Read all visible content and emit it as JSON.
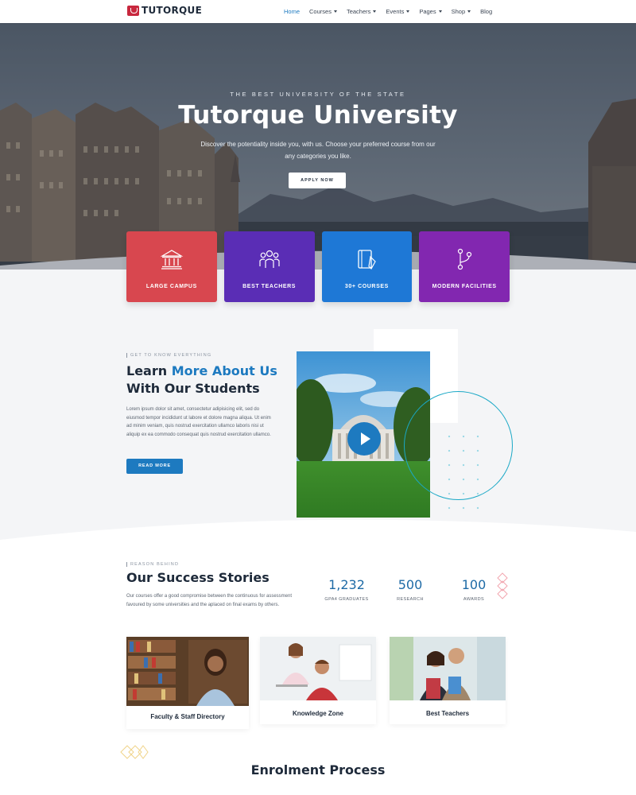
{
  "nav": {
    "logo": "TUTORQUE",
    "items": [
      {
        "label": "Home",
        "active": true,
        "dropdown": false
      },
      {
        "label": "Courses",
        "active": false,
        "dropdown": true
      },
      {
        "label": "Teachers",
        "active": false,
        "dropdown": true
      },
      {
        "label": "Events",
        "active": false,
        "dropdown": true
      },
      {
        "label": "Pages",
        "active": false,
        "dropdown": true
      },
      {
        "label": "Shop",
        "active": false,
        "dropdown": true
      },
      {
        "label": "Blog",
        "active": false,
        "dropdown": false
      }
    ]
  },
  "hero": {
    "kicker": "THE BEST UNIVERSITY OF THE STATE",
    "title": "Tutorque University",
    "subtitle": "Discover the potentiality inside you, with us. Choose your preferred course from our any categories  you like.",
    "button": "APPLY NOW"
  },
  "features": [
    {
      "label": "LARGE CAMPUS",
      "color": "#d8474f",
      "icon": "building-icon"
    },
    {
      "label": "BEST TEACHERS",
      "color": "#5a2db5",
      "icon": "people-icon"
    },
    {
      "label": "30+ COURSES",
      "color": "#1e78d6",
      "icon": "book-pencil-icon"
    },
    {
      "label": "MODERN FACILITIES",
      "color": "#8227b0",
      "icon": "branch-icon"
    }
  ],
  "about": {
    "kicker": "GET TO KNOW EVERYTHING",
    "title_pre": "Learn ",
    "title_accent": "More About Us",
    "title_line2": "With Our Students",
    "body": "Lorem ipsum dolor sit amet, consectetur adipisicing elit, sed do eiusmod tempor incididunt ut labore et dolore magna aliqua. Ut enim ad minim veniam, quis nostrud exercitation ullamco laboris nisi ut aliquip ex ea commodo consequat quis nostrud exercitation ullamco.",
    "button": "READ MORE"
  },
  "success": {
    "kicker": "REASON BEHIND",
    "title": "Our Success Stories",
    "body": "Our courses offer a good compromise between the continuous for assessment favoured by some universities and the aplaced on final exams by others.",
    "stats": [
      {
        "value": "1,232",
        "label": "GPA4 GRADUATES"
      },
      {
        "value": "500",
        "label": "RESEARCH"
      },
      {
        "value": "100",
        "label": "AWARDS"
      }
    ],
    "stories": [
      {
        "label": "Faculty & Staff Directory"
      },
      {
        "label": "Knowledge Zone"
      },
      {
        "label": "Best Teachers"
      }
    ]
  },
  "enrol": {
    "title": "Enrolment Process"
  }
}
